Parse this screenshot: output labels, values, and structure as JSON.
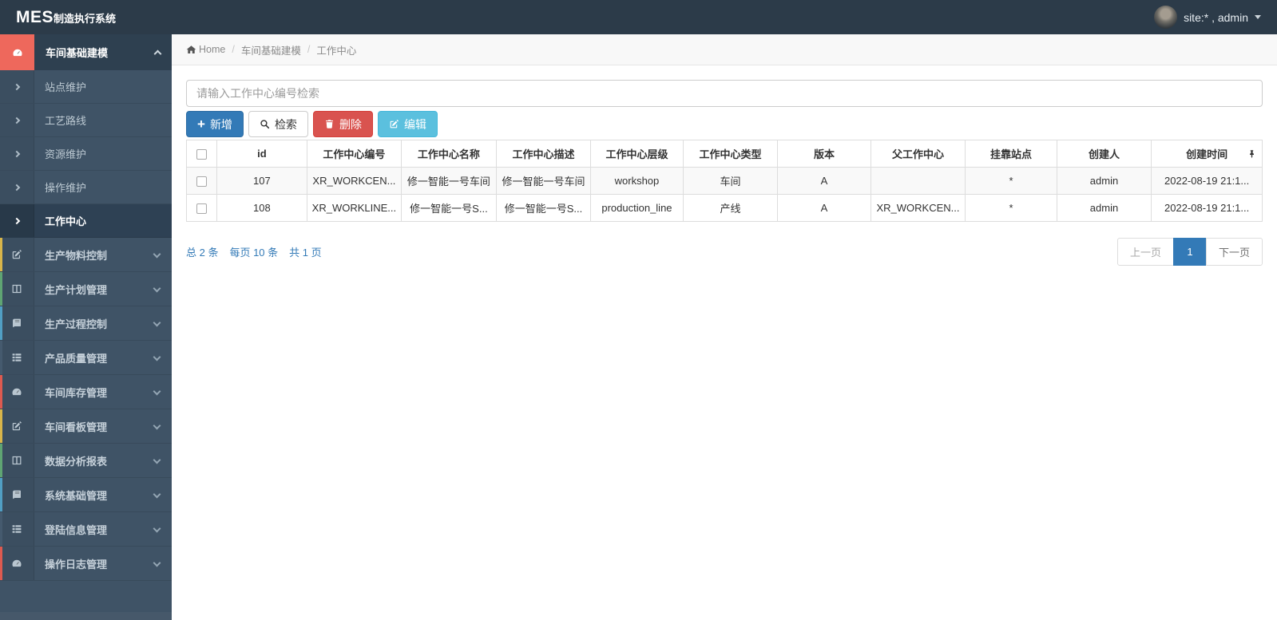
{
  "topbar": {
    "brand": "MES",
    "brand_suffix": "制造执行系统",
    "user_label": "site:* , admin"
  },
  "breadcrumb": {
    "home": "Home",
    "section": "车间基础建模",
    "page": "工作中心"
  },
  "sidebar": {
    "root": {
      "label": "车间基础建模",
      "icon": "dashboard-icon",
      "accent": "#ee685c"
    },
    "submenu": [
      {
        "label": "站点维护"
      },
      {
        "label": "工艺路线"
      },
      {
        "label": "资源维护"
      },
      {
        "label": "操作维护"
      },
      {
        "label": "工作中心",
        "active": true
      }
    ],
    "items": [
      {
        "label": "生产物料控制",
        "icon": "edit-icon",
        "accent": "#d8b54a"
      },
      {
        "label": "生产计划管理",
        "icon": "columns-icon",
        "accent": "#5fa573"
      },
      {
        "label": "生产过程控制",
        "icon": "book-icon",
        "accent": "#519fc4"
      },
      {
        "label": "产品质量管理",
        "icon": "list-icon",
        "accent": "#455a6e"
      },
      {
        "label": "车间库存管理",
        "icon": "dashboard-icon",
        "accent": "#dd5a50"
      },
      {
        "label": "车间看板管理",
        "icon": "edit-icon",
        "accent": "#d8b54a"
      },
      {
        "label": "数据分析报表",
        "icon": "columns-icon",
        "accent": "#5fa573"
      },
      {
        "label": "系统基础管理",
        "icon": "book-icon",
        "accent": "#519fc4"
      },
      {
        "label": "登陆信息管理",
        "icon": "list-icon",
        "accent": "#455a6e"
      },
      {
        "label": "操作日志管理",
        "icon": "dashboard-icon",
        "accent": "#dd5a50"
      }
    ]
  },
  "toolbar": {
    "search_placeholder": "请输入工作中心编号检索",
    "add_label": "新增",
    "search_label": "检索",
    "delete_label": "删除",
    "edit_label": "编辑"
  },
  "table": {
    "columns": [
      "id",
      "工作中心编号",
      "工作中心名称",
      "工作中心描述",
      "工作中心层级",
      "工作中心类型",
      "版本",
      "父工作中心",
      "挂靠站点",
      "创建人",
      "创建时间"
    ],
    "rows": [
      {
        "cells": [
          "107",
          "XR_WORKCEN...",
          "修一智能一号车间",
          "修一智能一号车间",
          "workshop",
          "车间",
          "A",
          "",
          "*",
          "admin",
          "2022-08-19 21:1..."
        ]
      },
      {
        "cells": [
          "108",
          "XR_WORKLINE...",
          "修一智能一号S...",
          "修一智能一号S...",
          "production_line",
          "产线",
          "A",
          "XR_WORKCEN...",
          "*",
          "admin",
          "2022-08-19 21:1..."
        ]
      }
    ]
  },
  "pagination": {
    "summary_total": "总 2 条",
    "summary_per_page": "每页 10 条",
    "summary_pages": "共 1 页",
    "prev_label": "上一页",
    "current_page": "1",
    "next_label": "下一页"
  },
  "icons": [
    "dashboard-icon",
    "edit-icon",
    "columns-icon",
    "book-icon",
    "list-icon",
    "home-icon",
    "plus-icon",
    "search-icon",
    "trash-icon",
    "pin-icon",
    "caret-down-icon",
    "chevron-right-icon",
    "chevron-down-icon",
    "chevron-up-icon"
  ],
  "colors": {
    "topbar_bg": "#2c3b49",
    "sidebar_bg": "#3f5366",
    "brand_coral": "#ee685c",
    "accent_blue": "#337ab7",
    "danger_red": "#d9534f",
    "info_cyan": "#5bc0de"
  }
}
